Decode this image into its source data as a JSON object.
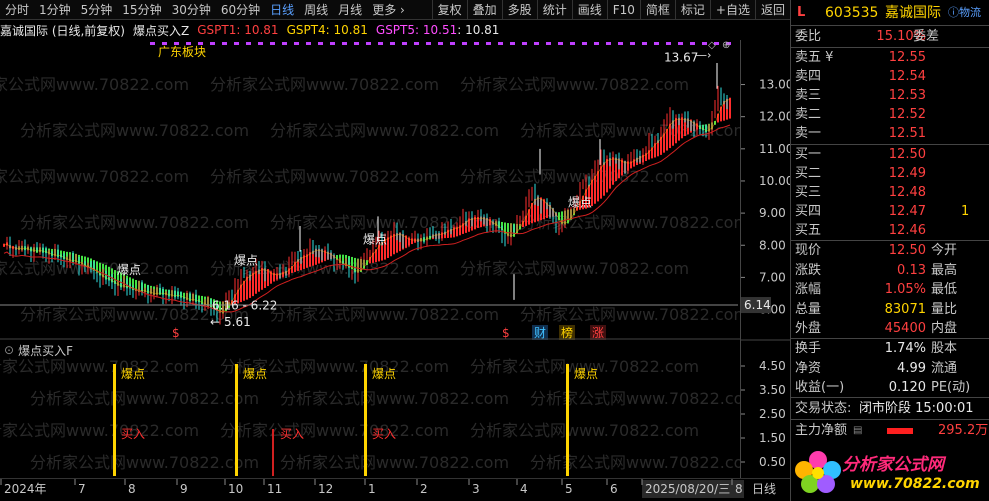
{
  "toolbar": {
    "periods": [
      "分时",
      "1分钟",
      "5分钟",
      "15分钟",
      "30分钟",
      "60分钟",
      "日线",
      "周线",
      "月线",
      "更多 ›"
    ],
    "active_period": "日线",
    "buttons": [
      "复权",
      "叠加",
      "多股",
      "统计",
      "画线",
      "F10",
      "简框",
      "标记",
      "+自选",
      "返回"
    ]
  },
  "info_bar": {
    "title": "嘉诚国际 (日线,前复权)",
    "indicator": "爆点买入Z",
    "gspt1": "GSPT1: 10.81",
    "gspt4": "GSPT4: 10.81",
    "gspt5": "GSPT5: 10.51",
    "gspt5b": ": 10.81"
  },
  "main_chart": {
    "sector_label": "广东板块",
    "high_label": "13.67",
    "low_label": "5.61",
    "range_label": "6.16 - 6.22",
    "current_line_label": "6.14",
    "signal_labels": [
      {
        "text": "爆点"
      },
      {
        "text": "爆点"
      },
      {
        "text": "爆点"
      },
      {
        "text": "爆点"
      }
    ],
    "event_badges": [
      "$",
      "$",
      "财",
      "榜",
      "涨"
    ],
    "y_ticks": [
      "13.00",
      "12.00",
      "11.00",
      "10.00",
      "9.00",
      "8.00",
      "7.00",
      "6.00"
    ],
    "watermark": "分析家公式网www.70822.com"
  },
  "sub_chart": {
    "title": "爆点买入F",
    "y_ticks": [
      "4.50",
      "3.50",
      "2.50",
      "1.50",
      "0.50"
    ],
    "signals": [
      {
        "type": "baodian",
        "label": "爆点",
        "label2": "买入"
      },
      {
        "type": "baodian",
        "label": "爆点"
      },
      {
        "type": "buy",
        "label": "买入"
      },
      {
        "type": "baodian",
        "label": "爆点",
        "label2": "买入"
      },
      {
        "type": "baodian",
        "label": "爆点"
      }
    ]
  },
  "date_axis": {
    "labels": [
      "2024年",
      "7",
      "8",
      "9",
      "10",
      "11",
      "12",
      "1",
      "2",
      "3",
      "4",
      "5",
      "6",
      "2025/08/20/三",
      "8"
    ],
    "period_label": "日线"
  },
  "quote_panel": {
    "flag": "L",
    "code": "603535",
    "name": "嘉诚国际",
    "tag": "物流",
    "weibi_label": "委比",
    "weibi_value": "15.10%",
    "weicha_label": "委差",
    "sells": [
      {
        "label": "卖五 ¥",
        "price": "12.55"
      },
      {
        "label": "卖四",
        "price": "12.54"
      },
      {
        "label": "卖三",
        "price": "12.53"
      },
      {
        "label": "卖二",
        "price": "12.52"
      },
      {
        "label": "卖一",
        "price": "12.51"
      }
    ],
    "buys": [
      {
        "label": "买一",
        "price": "12.50"
      },
      {
        "label": "买二",
        "price": "12.49"
      },
      {
        "label": "买三",
        "price": "12.48"
      },
      {
        "label": "买四",
        "price": "12.47",
        "vol": "1"
      },
      {
        "label": "买五",
        "price": "12.46"
      }
    ],
    "stats": [
      {
        "label": "现价",
        "value": "12.50",
        "label2": "今开"
      },
      {
        "label": "涨跌",
        "value": "0.13",
        "label2": "最高"
      },
      {
        "label": "涨幅",
        "value": "1.05%",
        "label2": "最低"
      },
      {
        "label": "总量",
        "value": "83071",
        "label2": "量比"
      },
      {
        "label": "外盘",
        "value": "45400",
        "label2": "内盘"
      }
    ],
    "stats2": [
      {
        "label": "换手",
        "value": "1.74%",
        "label2": "股本"
      },
      {
        "label": "净资",
        "value": "4.99",
        "label2": "流通"
      },
      {
        "label": "收益(一)",
        "value": "0.120",
        "label2": "PE(动)"
      }
    ],
    "trade_status_label": "交易状态:",
    "trade_status_value": "闭市阶段 15:00:01",
    "net_label": "主力净额",
    "net_value": "295.2万",
    "logo_text": "分析家公式网",
    "logo_url_text": "www.70822.com"
  },
  "colors": {
    "up": "#ff3030",
    "down": "#30e030",
    "yellow": "#ffd400",
    "axis": "#c8c8c8"
  }
}
